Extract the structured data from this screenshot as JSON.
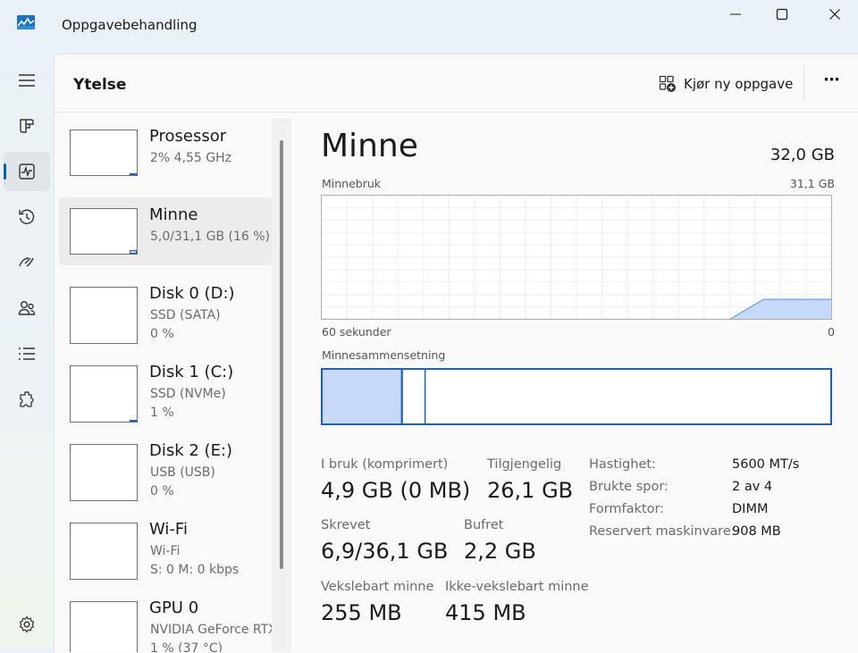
{
  "window": {
    "title": "Oppgavebehandling"
  },
  "nav": {
    "items": [
      {
        "icon": "hamburger-icon"
      },
      {
        "icon": "processes-icon"
      },
      {
        "icon": "performance-icon",
        "active": true
      },
      {
        "icon": "app-history-icon"
      },
      {
        "icon": "startup-apps-icon"
      },
      {
        "icon": "users-icon"
      },
      {
        "icon": "details-icon"
      },
      {
        "icon": "services-icon"
      }
    ],
    "settings_icon": "gear-icon"
  },
  "header": {
    "title": "Ytelse",
    "run_task_label": "Kjør ny oppgave",
    "more_label": "⋯"
  },
  "devices": [
    {
      "name": "Prosessor",
      "line1": "2%  4,55 GHz",
      "line2": "",
      "usage": 0.02
    },
    {
      "name": "Minne",
      "line1": "5,0/31,1 GB (16 %)",
      "line2": "",
      "usage": 0.16,
      "selected": true
    },
    {
      "name": "Disk 0 (D:)",
      "line1": "SSD (SATA)",
      "line2": "0 %",
      "usage": 0
    },
    {
      "name": "Disk 1 (C:)",
      "line1": "SSD (NVMe)",
      "line2": "1 %",
      "usage": 0.01
    },
    {
      "name": "Disk 2 (E:)",
      "line1": "USB (USB)",
      "line2": "0 %",
      "usage": 0
    },
    {
      "name": "Wi-Fi",
      "line1": "Wi-Fi",
      "line2": "S: 0  M: 0 kbps",
      "usage": 0
    },
    {
      "name": "GPU 0",
      "line1": "NVIDIA GeForce RTX",
      "line2": "1 % (37 °C)",
      "usage": 0.01
    }
  ],
  "memory": {
    "title": "Minne",
    "total": "32,0 GB",
    "usage_label": "Minnebruk",
    "usage_max": "31,1 GB",
    "time_label": "60 sekunder",
    "time_end": "0",
    "composition_label": "Minnesammensetning",
    "composition": {
      "in_use": 4.9,
      "modified": 0.2,
      "standby": 2.2,
      "total": 31.1
    },
    "stats": [
      {
        "label": "I bruk (komprimert)",
        "value": "4,9 GB (0 MB)"
      },
      {
        "label": "Tilgjengelig",
        "value": "26,1 GB"
      },
      {
        "label": "Skrevet",
        "value": "6,9/36,1 GB"
      },
      {
        "label": "Bufret",
        "value": "2,2 GB"
      },
      {
        "label": "Vekslebart minne",
        "value": "255 MB"
      },
      {
        "label": "Ikke-vekslebart minne",
        "value": "415 MB"
      }
    ],
    "props": [
      {
        "label": "Hastighet:",
        "value": "5600 MT/s"
      },
      {
        "label": "Brukte spor:",
        "value": "2 av 4"
      },
      {
        "label": "Formfaktor:",
        "value": "DIMM"
      },
      {
        "label": "Reservert maskinvare:",
        "value": "908 MB"
      }
    ]
  },
  "chart_data": {
    "type": "area",
    "title": "Minnebruk",
    "xlabel": "60 sekunder",
    "ylabel": "",
    "x": [
      0,
      5,
      10,
      15,
      20,
      25,
      30,
      35,
      40,
      45,
      48,
      52,
      55,
      60
    ],
    "values": [
      0,
      0,
      0,
      0,
      0,
      0,
      0,
      0,
      0,
      0,
      0,
      5.0,
      5.0,
      5.0
    ],
    "ylim": [
      0,
      31.1
    ],
    "xlim": [
      0,
      60
    ],
    "grid": true
  },
  "colors": {
    "accent": "#005fb8",
    "mem_fill": "#c6d9f8",
    "mem_line": "#1b5fbf"
  }
}
